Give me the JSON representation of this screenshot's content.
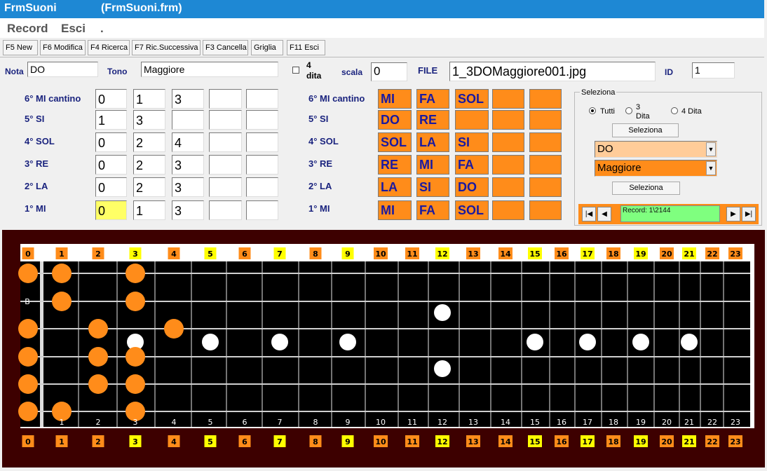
{
  "title": {
    "form": "FrmSuoni",
    "file": "(FrmSuoni.frm)"
  },
  "menu": [
    "Record",
    "Esci",
    "."
  ],
  "toolbar": [
    "F5 New",
    "F6 Modifica",
    "F4 Ricerca",
    "F7 Ric.Successiva",
    "F3 Cancella",
    "Griglia",
    "F11 Esci"
  ],
  "header": {
    "nota_label": "Nota",
    "nota_value": "DO",
    "tono_label": "Tono",
    "tono_value": "Maggiore",
    "dita_line1": "4",
    "dita_line2": "dita",
    "scala_label": "scala",
    "scala_value": "0",
    "file_label": "FILE",
    "file_value": "1_3DOMaggiore001.jpg",
    "id_label": "ID",
    "id_value": "1"
  },
  "strings": [
    {
      "label": "6° MI cantino",
      "frets": [
        "0",
        "1",
        "3",
        "",
        ""
      ],
      "notes": [
        "MI",
        "FA",
        "SOL",
        "",
        ""
      ]
    },
    {
      "label": "5° SI",
      "frets": [
        "1",
        "3",
        "",
        "",
        ""
      ],
      "notes": [
        "DO",
        "RE",
        "",
        "",
        ""
      ]
    },
    {
      "label": "4° SOL",
      "frets": [
        "0",
        "2",
        "4",
        "",
        ""
      ],
      "notes": [
        "SOL",
        "LA",
        "SI",
        "",
        ""
      ]
    },
    {
      "label": "3° RE",
      "frets": [
        "0",
        "2",
        "3",
        "",
        ""
      ],
      "notes": [
        "RE",
        "MI",
        "FA",
        "",
        ""
      ]
    },
    {
      "label": "2° LA",
      "frets": [
        "0",
        "2",
        "3",
        "",
        ""
      ],
      "notes": [
        "LA",
        "SI",
        "DO",
        "",
        ""
      ]
    },
    {
      "label": "1° MI",
      "frets": [
        "0",
        "1",
        "3",
        "",
        ""
      ],
      "notes": [
        "MI",
        "FA",
        "SOL",
        "",
        ""
      ]
    }
  ],
  "seleziona": {
    "group_label": "Seleziona",
    "radio_tutti": "Tutti",
    "radio_3dita_1": "3",
    "radio_3dita_2": "Dita",
    "radio_4dita": "4 Dita",
    "button1": "Seleziona",
    "combo_nota": "DO",
    "combo_tono": "Maggiore",
    "button2": "Seleziona",
    "record_text": "Record: 1\\2144"
  },
  "fretboard": {
    "fret_numbers": [
      "0",
      "1",
      "2",
      "3",
      "4",
      "5",
      "6",
      "7",
      "8",
      "9",
      "10",
      "11",
      "12",
      "13",
      "14",
      "15",
      "16",
      "17",
      "18",
      "19",
      "20",
      "21",
      "22",
      "23"
    ],
    "yellow_frets": [
      3,
      5,
      7,
      9,
      12,
      15,
      17,
      19,
      21
    ],
    "inlay_frets": [
      3,
      5,
      7,
      9,
      15,
      17,
      19,
      21
    ],
    "double_inlay_fret": 12,
    "string_letter": "B",
    "fingering": [
      {
        "string": 1,
        "fret": 0
      },
      {
        "string": 1,
        "fret": 1
      },
      {
        "string": 1,
        "fret": 3
      },
      {
        "string": 2,
        "fret": 1
      },
      {
        "string": 2,
        "fret": 3
      },
      {
        "string": 3,
        "fret": 0
      },
      {
        "string": 3,
        "fret": 2
      },
      {
        "string": 3,
        "fret": 4
      },
      {
        "string": 4,
        "fret": 0
      },
      {
        "string": 4,
        "fret": 2
      },
      {
        "string": 4,
        "fret": 3
      },
      {
        "string": 5,
        "fret": 0
      },
      {
        "string": 5,
        "fret": 2
      },
      {
        "string": 5,
        "fret": 3
      },
      {
        "string": 6,
        "fret": 0
      },
      {
        "string": 6,
        "fret": 1
      },
      {
        "string": 6,
        "fret": 3
      }
    ],
    "colors": {
      "dot": "#ff8c1a",
      "inlay": "#ffffff",
      "yellow": "#ffff00",
      "orange": "#ff8c1a",
      "board": "#000000",
      "frame": "#3d0000"
    }
  }
}
